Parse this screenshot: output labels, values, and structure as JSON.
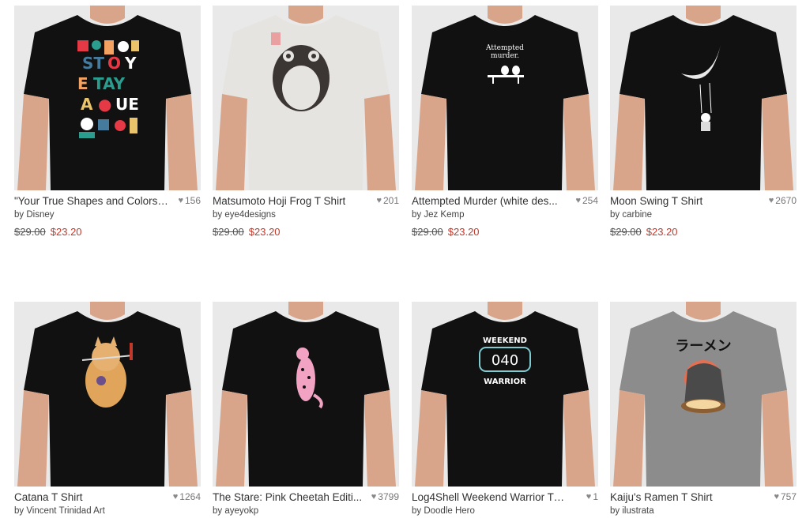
{
  "products": [
    {
      "title": "\"Your True Shapes and Colors ...",
      "likes": "156",
      "artist": "by Disney",
      "old_price": "$29.00",
      "price": "$23.20",
      "shirt_color": "#111111",
      "design": "shapes"
    },
    {
      "title": "Matsumoto Hoji Frog T Shirt",
      "likes": "201",
      "artist": "by eye4designs",
      "old_price": "$29.00",
      "price": "$23.20",
      "shirt_color": "#e6e4e0",
      "design": "frog"
    },
    {
      "title": "Attempted Murder (white des...",
      "likes": "254",
      "artist": "by Jez Kemp",
      "old_price": "$29.00",
      "price": "$23.20",
      "shirt_color": "#111111",
      "design": "birds",
      "design_text_1": "Attempted",
      "design_text_2": "murder."
    },
    {
      "title": "Moon Swing T Shirt",
      "likes": "2670",
      "artist": "by carbine",
      "old_price": "$29.00",
      "price": "$23.20",
      "shirt_color": "#111111",
      "design": "moon"
    },
    {
      "title": "Catana T Shirt",
      "likes": "1264",
      "artist": "by Vincent Trinidad Art",
      "shirt_color": "#111111",
      "design": "cat"
    },
    {
      "title": "The Stare: Pink Cheetah Editi...",
      "likes": "3799",
      "artist": "by ayeyokp",
      "shirt_color": "#111111",
      "design": "cheetah"
    },
    {
      "title": "Log4Shell Weekend Warrior T S...",
      "likes": "1",
      "artist": "by Doodle Hero",
      "shirt_color": "#111111",
      "design": "log4",
      "design_text_1": "WEEKEND",
      "design_text_2": "WARRIOR"
    },
    {
      "title": "Kaiju's Ramen T Shirt",
      "likes": "757",
      "artist": "by ilustrata",
      "shirt_color": "#8c8c8c",
      "design": "kaiju",
      "design_text_1": "ラーメン"
    }
  ],
  "colors": {
    "sale": "#c0392b",
    "tile_bg": "#e9e9e9",
    "skin": "#d8a58a"
  }
}
